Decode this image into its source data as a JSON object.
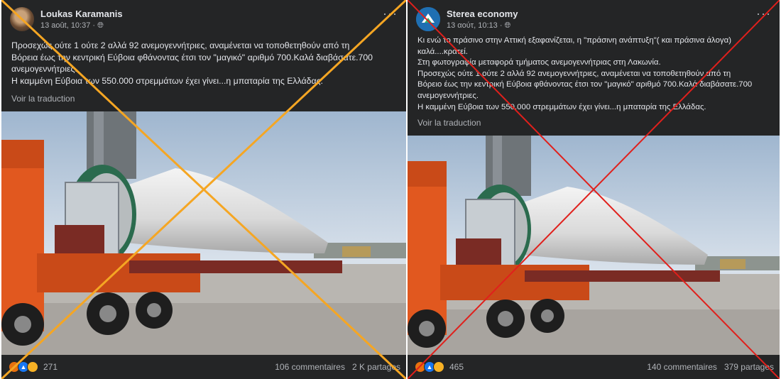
{
  "left": {
    "author": "Loukas Karamanis",
    "time": "13 août, 10:37 · ",
    "more": "···",
    "lines": [
      "Προσεχώς ούτε 1 ούτε 2 αλλά 92 ανεμογεννήτριες, αναμένεται να τοποθετηθούν από τη",
      "Βόρεια έως την κεντρική Εύβοια φθάνοντας έτσι τον \"μαγικό\" αριθμό 700.Καλά διαβάσατε.700",
      "ανεμογεννήτριες.",
      "Η καμμένη Εύβοια των 550.000 στρεμμάτων έχει γίνει...η μπαταρία της Ελλάδας."
    ],
    "translate": "Voir la traduction",
    "reaction_count": "271",
    "comments": "106 commentaires",
    "shares": "2 K partages"
  },
  "right": {
    "author": "Sterea economy",
    "time": "13 αούτ, 10:13 · ",
    "more": "···",
    "lines": [
      "Κι ενώ το πράσινο στην Αττική εξαφανίζεται, η \"πράσινη ανάπτυξη\"( και πράσινα άλογα)",
      "καλά....κρατεί.",
      "Στη φωτογραφία μεταφορά τμήματος ανεμογεννήτριας στη Λακωνία.",
      "Προσεχώς ούτε 1 ούτε 2 αλλά 92 ανεμογεννήτριες, αναμένεται να τοποθετηθούν από τη",
      "Βόρειο έως την κεντρική Εύβοια φθάνοντας έτσι τον \"μαγικό\" αριθμό 700.Καλά διαβάσατε.700",
      "ανεμογεννήτριες.",
      "Η καμμένη Εύβοια των 550.000 στρεμμάτων έχει γίνει...η μπαταρία της Ελλάδας."
    ],
    "translate": "Voir la traduction",
    "reaction_count": "465",
    "comments": "140 commentaires",
    "shares": "379 partages"
  },
  "icons": {
    "globe": "globe-icon",
    "angry": "angry-reaction-icon",
    "like": "like-reaction-icon",
    "sad": "sad-reaction-icon"
  },
  "colors": {
    "cross_left": "#f5a623",
    "cross_right": "#e0201c",
    "card_bg": "#242526"
  }
}
